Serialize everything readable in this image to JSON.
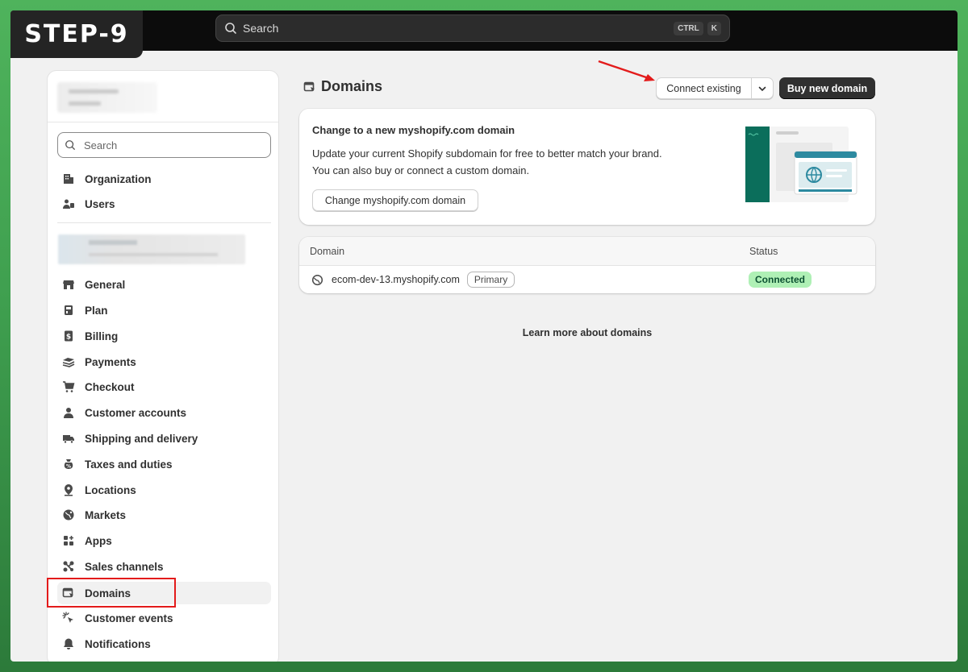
{
  "step_badge": "STEP-9",
  "topbar": {
    "search_placeholder": "Search",
    "shortcut_keys": [
      "CTRL",
      "K"
    ]
  },
  "sidebar": {
    "search_placeholder": "Search",
    "top_items": [
      {
        "label": "Organization",
        "icon": "organization-icon"
      },
      {
        "label": "Users",
        "icon": "users-icon"
      }
    ],
    "items": [
      {
        "label": "General",
        "icon": "store-icon"
      },
      {
        "label": "Plan",
        "icon": "plan-icon"
      },
      {
        "label": "Billing",
        "icon": "billing-icon"
      },
      {
        "label": "Payments",
        "icon": "payments-icon"
      },
      {
        "label": "Checkout",
        "icon": "cart-icon"
      },
      {
        "label": "Customer accounts",
        "icon": "person-icon"
      },
      {
        "label": "Shipping and delivery",
        "icon": "truck-icon"
      },
      {
        "label": "Taxes and duties",
        "icon": "tax-icon"
      },
      {
        "label": "Locations",
        "icon": "location-icon"
      },
      {
        "label": "Markets",
        "icon": "globe-icon"
      },
      {
        "label": "Apps",
        "icon": "apps-icon"
      },
      {
        "label": "Sales channels",
        "icon": "channels-icon"
      },
      {
        "label": "Domains",
        "icon": "domains-icon",
        "active": true
      },
      {
        "label": "Customer events",
        "icon": "cursor-click-icon"
      },
      {
        "label": "Notifications",
        "icon": "bell-icon"
      }
    ]
  },
  "main": {
    "title": "Domains",
    "connect_existing_label": "Connect existing",
    "buy_new_label": "Buy new domain",
    "promo": {
      "title": "Change to a new myshopify.com domain",
      "body_line1": "Update your current Shopify subdomain for free to better match your brand.",
      "body_line2": "You can also buy or connect a custom domain.",
      "button_label": "Change myshopify.com domain"
    },
    "table": {
      "headers": {
        "domain": "Domain",
        "status": "Status"
      },
      "rows": [
        {
          "domain": "ecom-dev-13.myshopify.com",
          "badge": "Primary",
          "status": "Connected"
        }
      ]
    },
    "learn_more": "Learn more about domains"
  },
  "colors": {
    "background_green": "#3f9f4f",
    "topbar": "#0c0c0c",
    "primary_button": "#303030",
    "connected_badge": "#aff0b5",
    "highlight_red": "#e31b1b",
    "illustration_teal": "#0b6e5b"
  }
}
